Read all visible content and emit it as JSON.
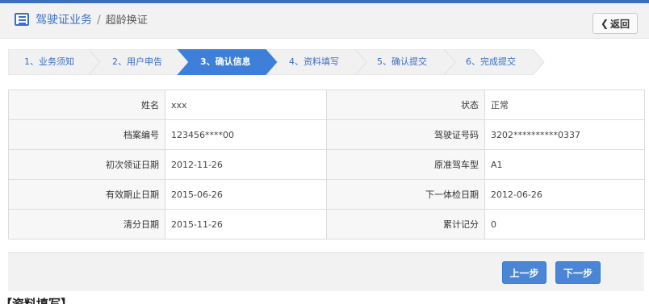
{
  "header": {
    "module": "驾驶证业务",
    "separator": "/",
    "page": "超龄换证",
    "back_label": "返回"
  },
  "steps": [
    {
      "label": "1、业务须知",
      "active": false
    },
    {
      "label": "2、用户申告",
      "active": false
    },
    {
      "label": "3、确认信息",
      "active": true
    },
    {
      "label": "4、资料填写",
      "active": false
    },
    {
      "label": "5、确认提交",
      "active": false
    },
    {
      "label": "6、完成提交",
      "active": false
    }
  ],
  "info": {
    "rows": [
      {
        "k1": "姓名",
        "v1": "xxx",
        "k2": "状态",
        "v2": "正常"
      },
      {
        "k1": "档案编号",
        "v1": "123456****00",
        "k2": "驾驶证号码",
        "v2": "3202**********0337"
      },
      {
        "k1": "初次领证日期",
        "v1": "2012-11-26",
        "k2": "原准驾车型",
        "v2": "A1"
      },
      {
        "k1": "有效期止日期",
        "v1": "2015-06-26",
        "k2": "下一体检日期",
        "v2": "2012-06-26"
      },
      {
        "k1": "清分日期",
        "v1": "2015-11-26",
        "k2": "累计记分",
        "v2": "0"
      }
    ]
  },
  "footer": {
    "prev_label": "上一步",
    "next_label": "下一步"
  },
  "next_section": "【资料填写】",
  "colors": {
    "accent": "#3a6fc4",
    "active_step": "#3d7fd9",
    "button": "#4a86d6"
  }
}
